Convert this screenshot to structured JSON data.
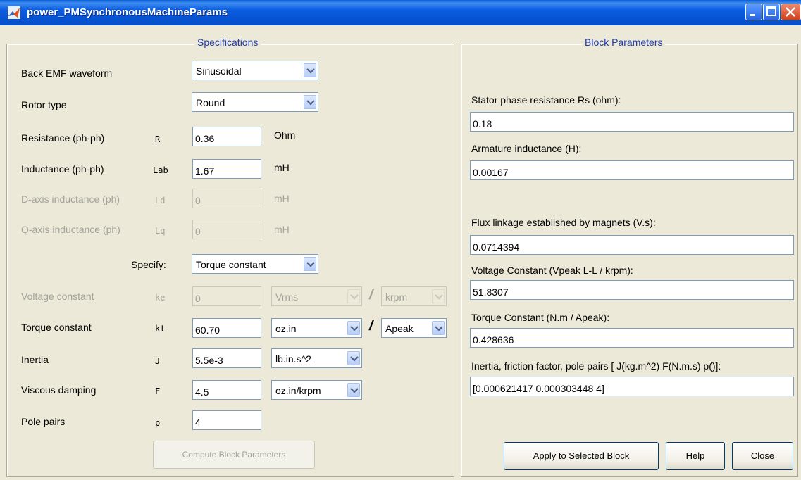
{
  "window": {
    "title": "power_PMSynchronousMachineParams"
  },
  "specifications": {
    "title": "Specifications",
    "back_emf": {
      "label": "Back EMF waveform",
      "value": "Sinusoidal"
    },
    "rotor_type": {
      "label": "Rotor type",
      "value": "Round"
    },
    "resistance": {
      "label": "Resistance (ph-ph)",
      "symbol": "R",
      "value": "0.36",
      "unit": "Ohm"
    },
    "inductance": {
      "label": "Inductance (ph-ph)",
      "symbol": "Lab",
      "value": "1.67",
      "unit": "mH"
    },
    "d_axis": {
      "label": "D-axis inductance (ph)",
      "symbol": "Ld",
      "value": "0",
      "unit": "mH"
    },
    "q_axis": {
      "label": "Q-axis inductance (ph)",
      "symbol": "Lq",
      "value": "0",
      "unit": "mH"
    },
    "specify": {
      "label": "Specify:",
      "value": "Torque constant"
    },
    "voltage_constant": {
      "label": "Voltage constant",
      "symbol": "ke",
      "value": "0",
      "unit1": "Vrms",
      "unit2": "krpm"
    },
    "torque_constant": {
      "label": "Torque constant",
      "symbol": "kt",
      "value": "60.70",
      "unit1": "oz.in",
      "unit2": "Apeak"
    },
    "inertia": {
      "label": "Inertia",
      "symbol": "J",
      "value": "5.5e-3",
      "unit": "lb.in.s^2"
    },
    "viscous": {
      "label": "Viscous damping",
      "symbol": "F",
      "value": "4.5",
      "unit": "oz.in/krpm"
    },
    "pole_pairs": {
      "label": "Pole pairs",
      "symbol": "p",
      "value": "4"
    },
    "slash": "/",
    "compute_button": "Compute Block Parameters"
  },
  "block_parameters": {
    "title": "Block Parameters",
    "stator_res": {
      "label": "Stator phase resistance Rs (ohm):",
      "value": "0.18"
    },
    "armature_ind": {
      "label": "Armature inductance (H):",
      "value": "0.00167"
    },
    "flux": {
      "label": "Flux linkage established by magnets (V.s):",
      "value": "0.0714394"
    },
    "voltage_const": {
      "label": "Voltage Constant (Vpeak L-L / krpm):",
      "value": "51.8307"
    },
    "torque_const": {
      "label": "Torque Constant (N.m / Apeak):",
      "value": "0.428636"
    },
    "inertia_etc": {
      "label": "Inertia, friction factor, pole pairs [ J(kg.m^2)  F(N.m.s)  p()]:",
      "value": "[0.000621417 0.000303448 4]"
    },
    "apply_button": "Apply to Selected Block",
    "help_button": "Help",
    "close_button": "Close"
  }
}
